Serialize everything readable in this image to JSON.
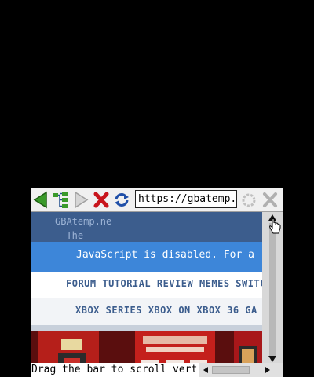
{
  "toolbar": {
    "url": "https://gbatemp.",
    "icons": [
      "back-icon",
      "sitemap-icon",
      "forward-icon",
      "stop-icon",
      "reload-icon",
      "loading-icon",
      "close-icon"
    ]
  },
  "site": {
    "title": "GBAtemp.ne\n- The",
    "js_notice": "JavaScript is disabled. For a",
    "nav_row1": "FORUM TUTORIAL REVIEW MEMES SWITCH",
    "nav_row2": "XBOX SERIES  XBOX ON XBOX 36 GA"
  },
  "status": {
    "text": "Drag the bar to scroll vert"
  },
  "colors": {
    "header": "#3c5d8d",
    "banner": "#3d86d9",
    "art": "#5a0e0e"
  }
}
